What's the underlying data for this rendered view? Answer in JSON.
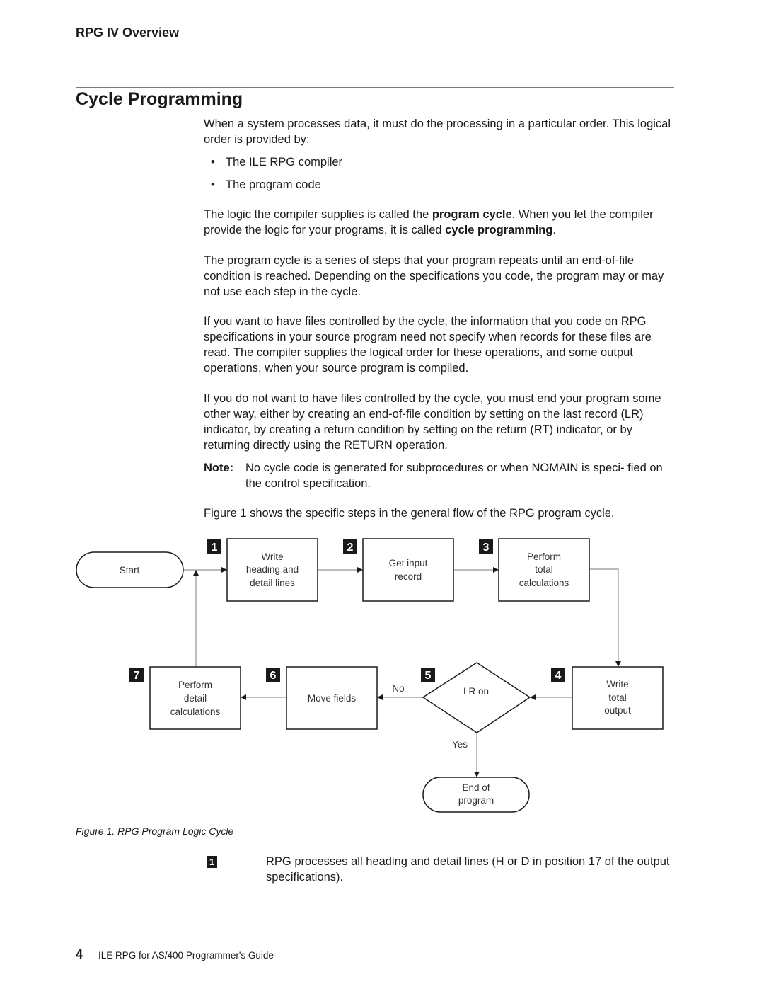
{
  "header": {
    "running_head": "RPG IV Overview",
    "section_title": "Cycle Programming"
  },
  "body": {
    "para1": "When a system processes data, it must do the processing in a particular order. This logical order is provided by:",
    "bullets": [
      "The ILE RPG compiler",
      "The program code"
    ],
    "para2": {
      "t1": "The logic the compiler supplies is called the ",
      "b1": "program cycle",
      "t2": ".  When you let the compiler provide the logic for your programs, it is called ",
      "b2": "cycle programming",
      "t3": "."
    },
    "para3": "The program cycle is a series of steps that your program repeats until an end-of-file condition is reached. Depending on the specifications you code, the program may or may not use each step in the cycle.",
    "para4": "If you want to have files controlled by the cycle, the information that you code on RPG specifications in your source program need not specify when records for these files are read. The compiler supplies the logical order for these operations, and some output operations, when your source program is compiled.",
    "para5": "If you do not want to have files controlled by the cycle, you must end your program some other way, either by creating an end-of-file condition by setting on the last record (LR) indicator, by creating a return condition by setting on the return (RT) indicator, or by returning directly using the RETURN operation.",
    "note_label": "Note:",
    "note_text": "No cycle code is generated for subprocedures or when NOMAIN is speci- fied on the control specification.",
    "para6": "Figure  1 shows the specific steps in the general flow of the RPG program cycle."
  },
  "diagram": {
    "start": "Start",
    "steps": [
      {
        "num": "1",
        "lines": [
          "Write",
          "heading and",
          "detail lines"
        ]
      },
      {
        "num": "2",
        "lines": [
          "Get input",
          "record"
        ]
      },
      {
        "num": "3",
        "lines": [
          "Perform",
          "total",
          "calculations"
        ]
      },
      {
        "num": "4",
        "lines": [
          "Write",
          "total",
          "output"
        ]
      },
      {
        "num": "5",
        "lines": [
          "LR on"
        ]
      },
      {
        "num": "6",
        "lines": [
          "Move fields"
        ]
      },
      {
        "num": "7",
        "lines": [
          "Perform",
          "detail",
          "calculations"
        ]
      }
    ],
    "no_label": "No",
    "yes_label": "Yes",
    "end": [
      "End of",
      "program"
    ]
  },
  "caption": "Figure  1.  RPG Program Logic Cycle",
  "callout": {
    "num": "1",
    "text": "RPG processes all heading and detail lines (H or D in position 17 of the output specifications)."
  },
  "footer": {
    "page_number": "4",
    "book_title": "ILE RPG for AS/400 Programmer's Guide"
  }
}
